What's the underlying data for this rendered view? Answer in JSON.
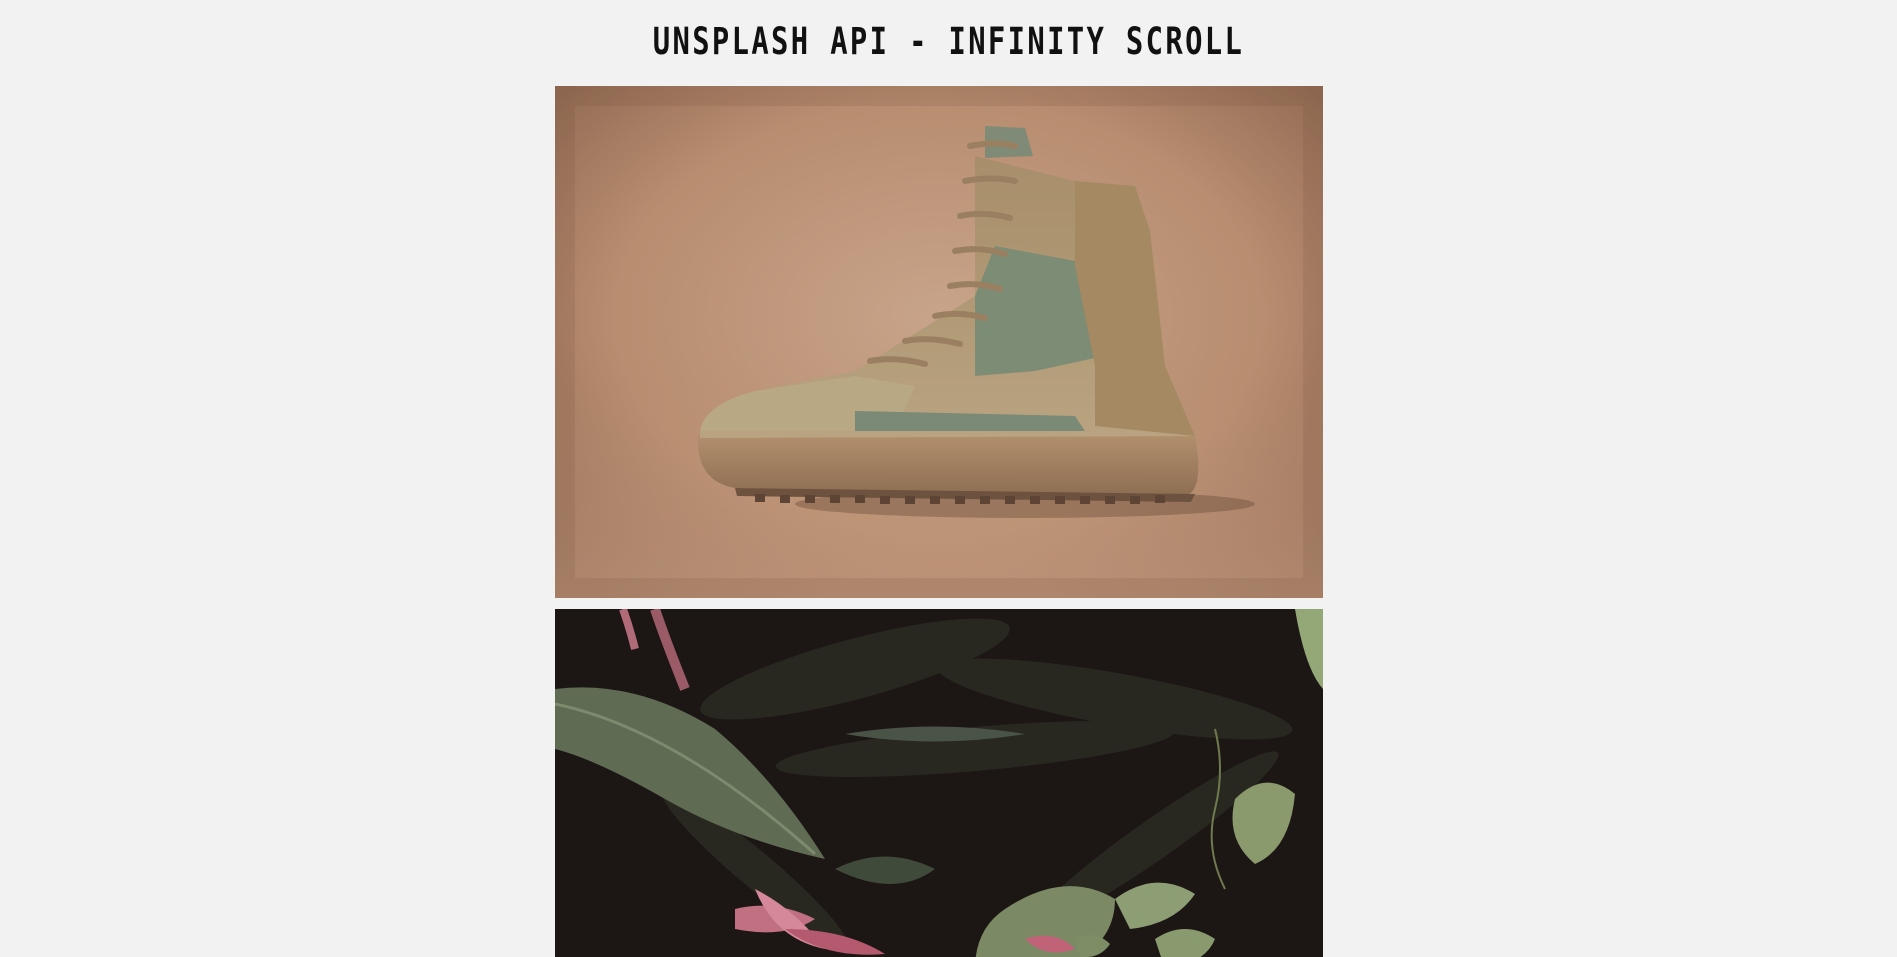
{
  "header": {
    "title": "UNSPLASH API - INFINITY SCROLL"
  },
  "colors": {
    "page_background": "#f2f2f2",
    "title_text": "#111111"
  }
}
